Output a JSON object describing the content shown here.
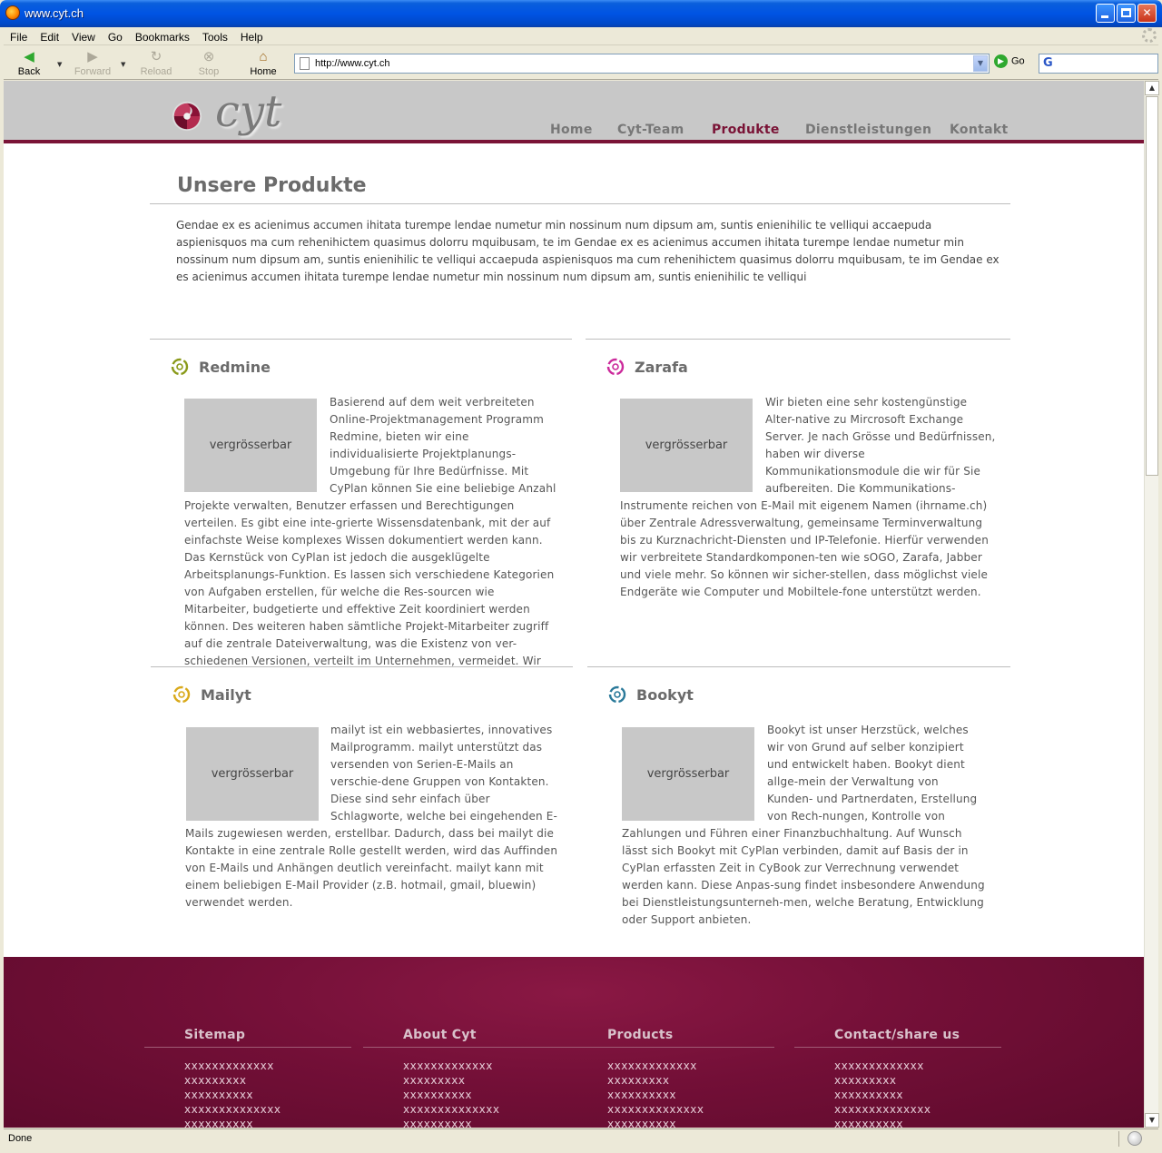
{
  "window": {
    "title": "www.cyt.ch"
  },
  "menu": [
    "File",
    "Edit",
    "View",
    "Go",
    "Bookmarks",
    "Tools",
    "Help"
  ],
  "toolbar": {
    "back": "Back",
    "forward": "Forward",
    "reload": "Reload",
    "stop": "Stop",
    "home": "Home",
    "url": "http://www.cyt.ch",
    "go": "Go"
  },
  "status": "Done",
  "site": {
    "logo": "cyt",
    "nav": [
      "Home",
      "Cyt-Team",
      "Produkte",
      "Dienstleistungen",
      "Kontakt"
    ],
    "active_nav": "Produkte",
    "page_title": "Unsere Produkte",
    "intro": "Gendae ex es acienimus accumen ihitata turempe lendae numetur min nossinum num dipsum am, suntis enienihilic te velliqui accaepuda aspienisquos ma cum rehenihictem quasimus dolorru mquibusam, te im Gendae ex es acienimus accumen ihitata turempe lendae numetur min nossinum num dipsum am, suntis enienihilic te velliqui accaepuda aspienisquos ma cum rehenihictem quasimus dolorru mquibusam, te im Gendae ex es acienimus accumen ihitata turempe lendae numetur min nossinum num dipsum am, suntis enienihilic te velliqui",
    "products": [
      {
        "name": "Redmine",
        "icon_color": "#8a9a1a",
        "thumb_label": "vergrösserbar",
        "text": "Basierend auf dem weit verbreiteten Online-Projektmanagement Programm Redmine, bieten wir eine individualisierte Projektplanungs-Umgebung für Ihre Bedürfnisse. Mit CyPlan können Sie eine beliebige Anzahl Projekte verwalten, Benutzer erfassen und Berechtigungen verteilen. Es gibt eine inte-grierte Wissensdatenbank, mit der auf einfachste Weise komplexes Wissen dokumentiert werden kann. Das Kernstück von CyPlan ist jedoch die ausgeklügelte Arbeitsplanungs-Funktion. Es lassen sich verschiedene Kategorien von Aufgaben erstellen, für welche die Res-sourcen wie Mitarbeiter, budgetierte und effektive Zeit koordiniert werden können. Des weiteren haben sämtliche Projekt-Mitarbeiter zugriff auf die zentrale Dateiverwaltung, was die Existenz von ver-schiedenen Versionen, verteilt im Unternehmen, vermeidet. Wir"
      },
      {
        "name": "Zarafa",
        "icon_color": "#cc2b9c",
        "thumb_label": "vergrösserbar",
        "text": "Wir bieten eine sehr kostengünstige Alter-native zu Mircrosoft Exchange Server. Je nach Grösse und Bedürfnissen, haben wir diverse Kommunikationsmodule die wir für Sie aufbereiten. Die Kommunikations-Instrumente reichen von E-Mail mit eigenem Namen (ihrname.ch) über Zentrale Adressverwaltung, gemeinsame Terminverwaltung bis zu Kurznachricht-Diensten und IP-Telefonie. Hierfür verwenden wir verbreitete Standardkomponen-ten wie sOGO, Zarafa, Jabber und viele mehr. So können wir sicher-stellen, dass möglichst viele Endgeräte wie Computer und Mobiltele-fone unterstützt werden."
      },
      {
        "name": "Mailyt",
        "icon_color": "#d9a91a",
        "thumb_label": "vergrösserbar",
        "text": "mailyt ist ein webbasiertes, innovatives Mailprogramm. mailyt unterstützt das versenden von Serien-E-Mails an verschie-dene Gruppen von Kontakten. Diese sind sehr einfach über Schlagworte, welche bei eingehenden E-Mails zugewiesen werden, erstellbar. Dadurch, dass bei mailyt die Kontakte in eine zentrale Rolle gestellt werden, wird das Auffinden von E-Mails und Anhängen deutlich vereinfacht. mailyt kann mit einem beliebigen E-Mail Provider (z.B. hotmail, gmail, bluewin) verwendet werden."
      },
      {
        "name": "Bookyt",
        "icon_color": "#2b7a9a",
        "thumb_label": "vergrösserbar",
        "text": "Bookyt ist unser Herzstück, welches wir von Grund auf selber konzipiert und entwickelt haben. Bookyt dient allge-mein der Verwaltung von Kunden- und Partnerdaten, Erstellung von Rech-nungen, Kontrolle von Zahlungen und Führen einer Finanzbuchhaltung. Auf Wunsch lässt sich Bookyt mit CyPlan verbinden, damit auf Basis der in CyPlan erfassten Zeit in CyBook zur Verrechnung verwendet werden kann. Diese Anpas-sung findet insbesondere Anwendung bei Dienstleistungsunterneh-men, welche Beratung, Entwicklung oder Support anbieten."
      }
    ],
    "footer": [
      {
        "title": "Sitemap",
        "items": [
          "xxxxxxxxxxxxx",
          "xxxxxxxxx",
          "xxxxxxxxxx",
          "xxxxxxxxxxxxxx",
          "xxxxxxxxxx"
        ]
      },
      {
        "title": "About Cyt",
        "items": [
          "xxxxxxxxxxxxx",
          "xxxxxxxxx",
          "xxxxxxxxxx",
          "xxxxxxxxxxxxxx",
          "xxxxxxxxxx"
        ]
      },
      {
        "title": "Products",
        "items": [
          "xxxxxxxxxxxxx",
          "xxxxxxxxx",
          "xxxxxxxxxx",
          "xxxxxxxxxxxxxx",
          "xxxxxxxxxx"
        ]
      },
      {
        "title": "Contact/share us",
        "items": [
          "xxxxxxxxxxxxx",
          "xxxxxxxxx",
          "xxxxxxxxxx",
          "xxxxxxxxxxxxxx",
          "xxxxxxxxxx"
        ]
      }
    ]
  }
}
